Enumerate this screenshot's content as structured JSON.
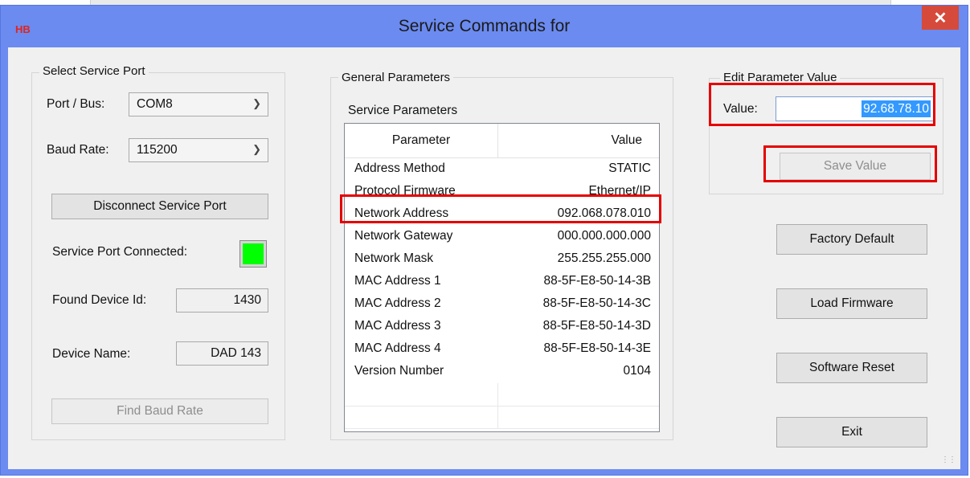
{
  "window": {
    "app_logo": "HB",
    "title": "Service Commands for",
    "close_glyph": "✕",
    "accent_color": "#6b8bf0"
  },
  "service_port": {
    "group_title": "Select Service Port",
    "port_label": "Port / Bus:",
    "port_value": "COM8",
    "baud_label": "Baud Rate:",
    "baud_value": "115200",
    "disconnect_label": "Disconnect Service Port",
    "connected_label": "Service Port Connected:",
    "connected_state": "connected",
    "connected_color": "#00ff00",
    "device_id_label": "Found Device Id:",
    "device_id_value": "1430",
    "device_name_label": "Device Name:",
    "device_name_value": "DAD 143",
    "find_baud_label": "Find Baud Rate"
  },
  "general": {
    "group_title": "General Parameters",
    "section_label": "Service Parameters",
    "columns": [
      "Parameter",
      "Value"
    ],
    "rows": [
      {
        "k": "Address Method",
        "v": "STATIC"
      },
      {
        "k": "Protocol Firmware",
        "v": "Ethernet/IP"
      },
      {
        "k": "Network Address",
        "v": "092.068.078.010"
      },
      {
        "k": "Network Gateway",
        "v": "000.000.000.000"
      },
      {
        "k": "Network Mask",
        "v": "255.255.255.000"
      },
      {
        "k": "MAC Address 1",
        "v": "88-5F-E8-50-14-3B"
      },
      {
        "k": "MAC Address 2",
        "v": "88-5F-E8-50-14-3C"
      },
      {
        "k": "MAC Address 3",
        "v": "88-5F-E8-50-14-3D"
      },
      {
        "k": "MAC Address 4",
        "v": "88-5F-E8-50-14-3E"
      },
      {
        "k": "Version Number",
        "v": "0104"
      }
    ]
  },
  "edit": {
    "group_title": "Edit Parameter Value",
    "value_label": "Value:",
    "value": "92.68.78.10",
    "save_label": "Save Value"
  },
  "actions": {
    "factory_default": "Factory Default",
    "load_firmware": "Load Firmware",
    "software_reset": "Software Reset",
    "exit": "Exit"
  },
  "highlight_color": "#e60000"
}
